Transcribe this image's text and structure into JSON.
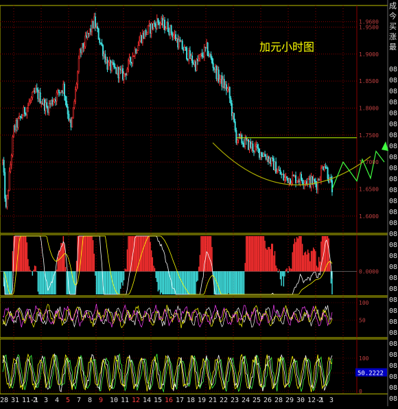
{
  "chart_data": {
    "type": "candlestick",
    "annotation": "加元小时图",
    "main_panel": {
      "y_ticks": [
        1.96,
        1.95,
        1.9,
        1.85,
        1.8,
        1.75,
        1.7,
        1.65,
        1.6
      ],
      "y_tick_labels": [
        "1.9600",
        "1.9500",
        "1.9000",
        "1.8500",
        "1.8000",
        "1.7500",
        "1.7000",
        "1.6500",
        "1.6000"
      ],
      "ylim": [
        1.568,
        1.99
      ],
      "candles_count": 300,
      "key_prices": [
        {
          "t": 0,
          "p": 1.7
        },
        {
          "t": 3,
          "p": 1.61
        },
        {
          "t": 10,
          "p": 1.76
        },
        {
          "t": 30,
          "p": 1.83
        },
        {
          "t": 40,
          "p": 1.8
        },
        {
          "t": 55,
          "p": 1.84
        },
        {
          "t": 62,
          "p": 1.76
        },
        {
          "t": 70,
          "p": 1.9
        },
        {
          "t": 83,
          "p": 1.96
        },
        {
          "t": 95,
          "p": 1.88
        },
        {
          "t": 110,
          "p": 1.86
        },
        {
          "t": 125,
          "p": 1.93
        },
        {
          "t": 140,
          "p": 1.96
        },
        {
          "t": 150,
          "p": 1.95
        },
        {
          "t": 160,
          "p": 1.92
        },
        {
          "t": 175,
          "p": 1.88
        },
        {
          "t": 185,
          "p": 1.91
        },
        {
          "t": 195,
          "p": 1.86
        },
        {
          "t": 205,
          "p": 1.83
        },
        {
          "t": 212,
          "p": 1.745
        },
        {
          "t": 225,
          "p": 1.73
        },
        {
          "t": 240,
          "p": 1.71
        },
        {
          "t": 255,
          "p": 1.67
        },
        {
          "t": 270,
          "p": 1.67
        },
        {
          "t": 285,
          "p": 1.66
        },
        {
          "t": 292,
          "p": 1.7
        },
        {
          "t": 299,
          "p": 1.65
        }
      ],
      "resistance_level": 1.745,
      "projection_path": [
        [
          1.65,
          1.7
        ],
        [
          1.665,
          1.705
        ],
        [
          1.67,
          1.72
        ],
        [
          1.7,
          1.745
        ]
      ]
    },
    "macd_panel": {
      "y_tick_labels": [
        "0.0000"
      ]
    },
    "rsi_panel": {
      "y_tick_labels": [
        "100",
        "50"
      ]
    },
    "kdj_panel": {
      "y_tick_labels": [
        "100",
        "50",
        "0"
      ],
      "current_value_label": "50.2222"
    },
    "x_tick_labels": [
      "28",
      "31",
      "11-1",
      "2",
      "3",
      "4",
      "5",
      "7",
      "8",
      "9",
      "10",
      "11",
      "12",
      "14",
      "15",
      "16",
      "17",
      "18",
      "19",
      "21",
      "22",
      "23",
      "24",
      "25",
      "26",
      "28",
      "29",
      "30",
      "12-1",
      "2",
      "3"
    ],
    "right_info_panel": {
      "header_lines": [
        "成",
        "今",
        "买",
        "涨",
        "最"
      ],
      "value_label": "08"
    },
    "colors": {
      "up": "#ff3030",
      "down": "#40e0e0",
      "grid": "#8b0000",
      "panel_border": "#c0c000",
      "annotation": "#ffff00",
      "arc": "#b0b000",
      "projection": "#40ff40",
      "resistance": "#c0ff00"
    }
  }
}
